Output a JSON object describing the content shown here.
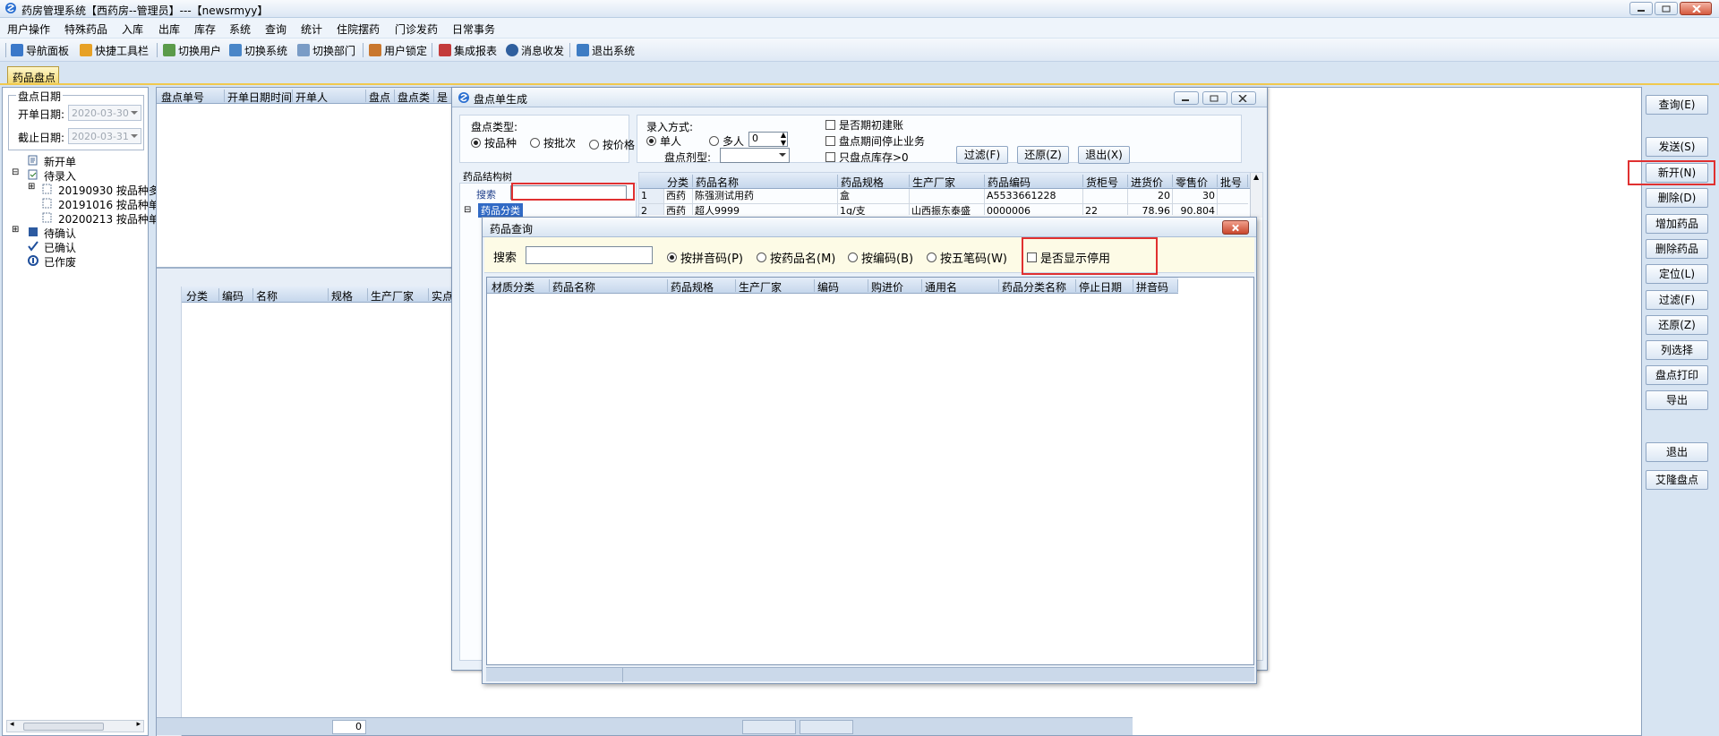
{
  "app": {
    "title": "药房管理系统【西药房--管理员】---【newsrmyy】"
  },
  "menu": [
    "用户操作",
    "特殊药品",
    "入库",
    "出库",
    "库存",
    "系统",
    "查询",
    "统计",
    "住院摆药",
    "门诊发药",
    "日常事务"
  ],
  "toolbar": {
    "items": [
      "导航面板",
      "快捷工具栏",
      "切换用户",
      "切换系统",
      "切换部门",
      "用户锁定",
      "集成报表",
      "消息收发",
      "退出系统"
    ]
  },
  "doc_tab": "药品盘点",
  "left": {
    "group_label": "盘点日期",
    "start_label": "开单日期:",
    "start_value": "2020-03-30",
    "end_label": "截止日期:",
    "end_value": "2020-03-31",
    "tree": [
      "新开单",
      "待录入",
      "20190930 按品种多",
      "20191016 按品种单",
      "20200213 按品种单",
      "待确认",
      "已确认",
      "已作废"
    ]
  },
  "upper_grid": {
    "headers": [
      "盘点单号",
      "开单日期时间",
      "开单人",
      "盘点",
      "盘点类",
      "是"
    ]
  },
  "lower_grid": {
    "headers": [
      "分类",
      "编码",
      "名称",
      "规格",
      "生产厂家",
      "实点"
    ]
  },
  "bottom_total": "0",
  "right_buttons": [
    "查询(E)",
    "发送(S)",
    "新开(N)",
    "删除(D)",
    "增加药品",
    "删除药品",
    "定位(L)",
    "过滤(F)",
    "还原(Z)",
    "列选择",
    "盘点打印",
    "导出",
    "退出",
    "艾隆盘点"
  ],
  "dlg1": {
    "title": "盘点单生成",
    "type_label": "盘点类型:",
    "type_options": [
      "按品种",
      "按批次",
      "按价格"
    ],
    "input_label": "录入方式:",
    "input_options": [
      "单人",
      "多人"
    ],
    "count_value": "0",
    "form_label": "盘点剂型:",
    "checks": [
      "是否期初建账",
      "盘点期间停止业务",
      "只盘点库存>0"
    ],
    "buttons": [
      "过滤(F)",
      "还原(Z)",
      "退出(X)"
    ],
    "tree_label": "药品结构树",
    "search_label": "搜索",
    "tree_node": "药品分类",
    "grid_headers": [
      "分类",
      "药品名称",
      "药品规格",
      "生产厂家",
      "药品编码",
      "货柜号",
      "进货价",
      "零售价",
      "批号"
    ],
    "rows": [
      {
        "no": "1",
        "cat": "西药",
        "name": "陈强测试用药",
        "spec": "盒",
        "maker": "",
        "code": "A5533661228",
        "shelf": "",
        "buy": "20",
        "sell": "30"
      },
      {
        "no": "2",
        "cat": "西药",
        "name": "超人9999",
        "spec": "1g/支",
        "maker": "山西振东泰盛",
        "code": "0000006",
        "shelf": "22",
        "buy": "78.96",
        "sell": "90.804"
      }
    ]
  },
  "dlg2": {
    "title": "药品查询",
    "search_label": "搜索",
    "search_value": "",
    "options": [
      "按拼音码(P)",
      "按药品名(M)",
      "按编码(B)",
      "按五笔码(W)"
    ],
    "show_disabled": "是否显示停用",
    "grid_headers": [
      "材质分类",
      "药品名称",
      "药品规格",
      "生产厂家",
      "编码",
      "购进价",
      "通用名",
      "药品分类名称",
      "停止日期",
      "拼音码"
    ]
  },
  "colors": {
    "highlight_red": "#e03030",
    "accent_blue": "#316ac5",
    "tab_yellow": "#f3d973"
  }
}
